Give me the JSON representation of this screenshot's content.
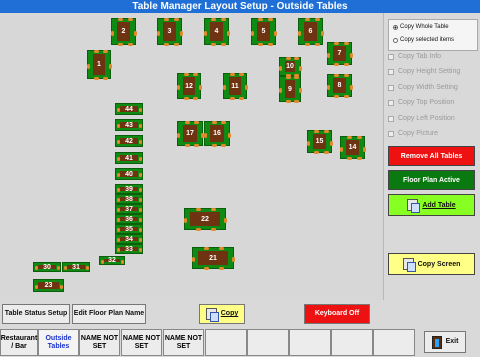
{
  "window": {
    "title": "Table Manager Layout Setup - Outside Tables"
  },
  "tables": [
    {
      "label": "1"
    },
    {
      "label": "2"
    },
    {
      "label": "3"
    },
    {
      "label": "4"
    },
    {
      "label": "5"
    },
    {
      "label": "6"
    },
    {
      "label": "7"
    },
    {
      "label": "8"
    },
    {
      "label": "9"
    },
    {
      "label": "10"
    },
    {
      "label": "11"
    },
    {
      "label": "12"
    },
    {
      "label": "14"
    },
    {
      "label": "15"
    },
    {
      "label": "16"
    },
    {
      "label": "17"
    },
    {
      "label": "21"
    },
    {
      "label": "22"
    },
    {
      "label": "23"
    },
    {
      "label": "30"
    },
    {
      "label": "31"
    },
    {
      "label": "32"
    },
    {
      "label": "33"
    },
    {
      "label": "34"
    },
    {
      "label": "35"
    },
    {
      "label": "36"
    },
    {
      "label": "37"
    },
    {
      "label": "38"
    },
    {
      "label": "39"
    },
    {
      "label": "40"
    },
    {
      "label": "41"
    },
    {
      "label": "42"
    },
    {
      "label": "43"
    },
    {
      "label": "44"
    }
  ],
  "side_panel": {
    "copy_whole_table": "Copy Whole Table",
    "copy_selected_items": "Copy selected items",
    "copy_tab_info": "Copy Tab Info",
    "copy_height_setting": "Copy Height Setting",
    "copy_width_setting": "Copy Width Setting",
    "copy_top_position": "Copy Top Position",
    "copy_left_position": "Copy Left Position",
    "copy_picture": "Copy Picture",
    "remove_all_tables": "Remove All Tables",
    "floor_plan_active": "Floor Plan Active",
    "add_table": "Add Table",
    "copy_screen": "Copy Screen"
  },
  "bottom_bar": {
    "table_status_setup": "Table Status Setup",
    "edit_floor_plan_name": "Edit Floor Plan Name",
    "copy": "Copy",
    "keyboard_off": "Keyboard Off",
    "exit": "Exit",
    "tabs": [
      {
        "label": "Restaurant / Bar"
      },
      {
        "label": "Outside Tables"
      },
      {
        "label": "NAME NOT SET"
      },
      {
        "label": "NAME NOT SET"
      },
      {
        "label": "NAME NOT SET"
      }
    ]
  },
  "colors": {
    "title_bar": "#1f6fd6",
    "table_border": "#0f8a12",
    "table_fill": "#6e3311",
    "seat": "#e08a2c",
    "remove_button": "#ee1111",
    "floor_plan_button": "#0a7a10",
    "add_table_button": "#88ff22",
    "copy_screen_button": "#ffff88",
    "keyboard_off_button": "#ee1111"
  }
}
